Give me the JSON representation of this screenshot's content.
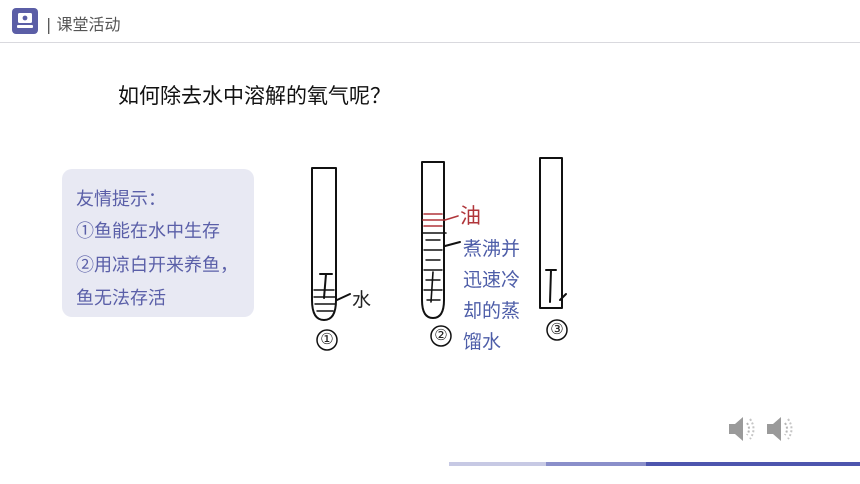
{
  "header": {
    "title": "| 课堂活动",
    "logo_icon": "classroom-logo-icon",
    "accent": "#5b5ea6"
  },
  "question": "如何除去水中溶解的氧气呢？",
  "hint": {
    "title": "友情提示：",
    "items": [
      "①鱼能在水中生存",
      "②用凉白开来养鱼，",
      "鱼无法存活"
    ]
  },
  "tubes": {
    "tube1": {
      "number": "①",
      "label": "水"
    },
    "tube2": {
      "number": "②",
      "oil_label": "油",
      "label_lines": [
        "煮沸并",
        "迅速冷",
        "却的蒸",
        "馏水"
      ]
    },
    "tube3": {
      "number": "③"
    }
  },
  "audio": {
    "icons": [
      "speaker-icon",
      "speaker-icon"
    ]
  },
  "progress": {
    "value": 0.48,
    "colors": [
      "#c7c9e4",
      "#8a8fca",
      "#4d55ae"
    ]
  }
}
